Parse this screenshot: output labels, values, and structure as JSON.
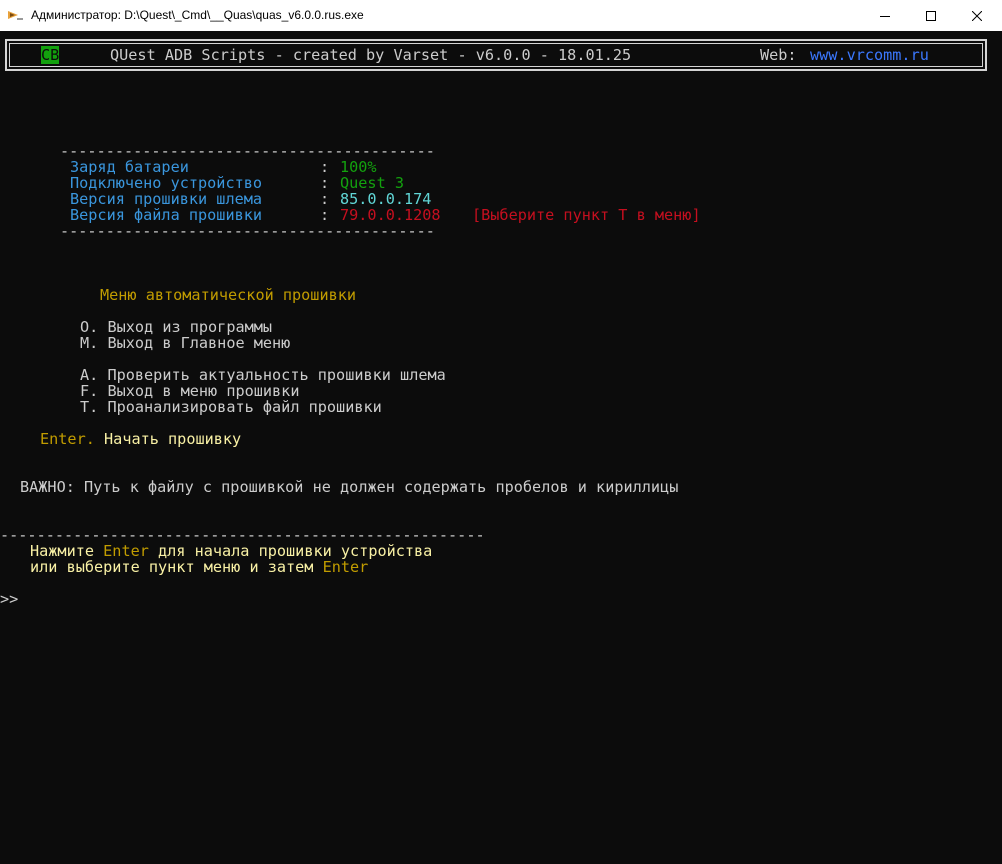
{
  "window": {
    "title": "Администратор: D:\\Quest\\_Cmd\\__Quas\\quas_v6.0.0.rus.exe",
    "app_icon": "terminal-app-icon",
    "controls": [
      "minimize-icon",
      "maximize-icon",
      "close-icon"
    ]
  },
  "header": {
    "badge": "CB",
    "title": "QUest ADB Scripts - created by Varset - v6.0.0 - 18.01.25",
    "web_label": "Web:",
    "web_link": "www.vrcomm.ru"
  },
  "status": {
    "separator": "-----------------------------------------",
    "rows": [
      {
        "label": "Заряд батареи          ",
        "colon": ":",
        "value": "100%"
      },
      {
        "label": "Подключено устройство  ",
        "colon": ":",
        "value": "Quest 3"
      },
      {
        "label": "Версия прошивки шлема  ",
        "colon": ":",
        "value": "85.0.0.174"
      },
      {
        "label": "Версия файла прошивки  ",
        "colon": ":",
        "value": "79.0.0.1208",
        "note": "[Выберите пункт T в меню]"
      }
    ]
  },
  "menu": {
    "title": "Меню автоматической прошивки",
    "items": [
      {
        "key": "O.",
        "label": "Выход из программы"
      },
      {
        "key": "M.",
        "label": "Выход в Главное меню"
      },
      {
        "key": "A.",
        "label": "Проверить актуальность прошивки шлема"
      },
      {
        "key": "F.",
        "label": "Выход в меню прошивки"
      },
      {
        "key": "T.",
        "label": "Проанализировать файл прошивки"
      }
    ],
    "enter_key": "Enter.",
    "enter_label": "Начать прошивку"
  },
  "warning": "ВАЖНО: Путь к файлу с прошивкой не должен содержать пробелов и кириллицы",
  "footer": {
    "separator": "-----------------------------------------------------",
    "line1_a": "Нажмите ",
    "line1_key": "Enter",
    "line1_b": " для начала прошивки устройства",
    "line2_a": "или выберите пункт меню и затем ",
    "line2_key": "Enter"
  },
  "prompt": ">>",
  "colors": {
    "background": "#0c0c0c",
    "text": "#cccccc",
    "label_blue": "#3a96dd",
    "ok_green": "#13a10e",
    "cyan": "#61d6d6",
    "error_red": "#c50f1f",
    "menu_yellow": "#c19c00",
    "light_yellow": "#f9f1a5",
    "link_blue": "#3b78ff"
  }
}
